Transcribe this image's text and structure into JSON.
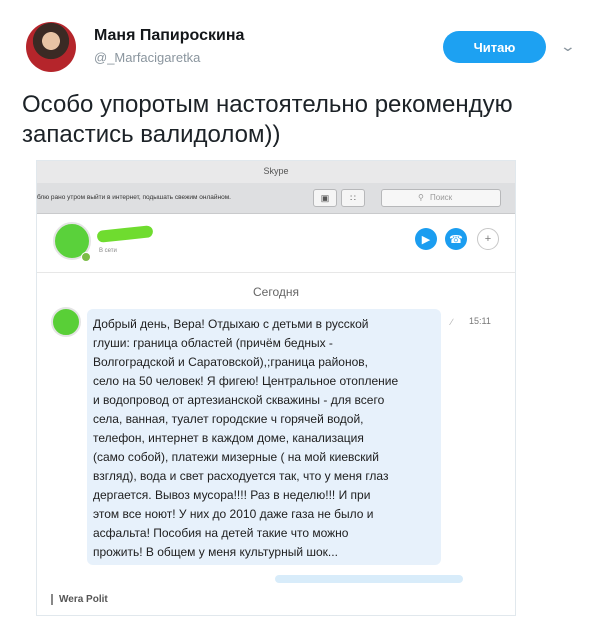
{
  "tweet": {
    "display_name": "Маня Папироскина",
    "handle": "@_Marfacigaretka",
    "follow_label": "Читаю",
    "menu_icon": "chevron-down-icon",
    "text": "Особо упоротым настоятельно рекомендую запастись валидолом))"
  },
  "skype": {
    "window_title": "Skype",
    "status_text": "блю рано утром выйти в интернет, подышать свежим онлайном.",
    "search_placeholder": "Поиск",
    "contact_status": "В сети",
    "date_separator": "Сегодня",
    "message": {
      "time": "15:11",
      "text": "Добрый день, Вера! Отдыхаю с детьми в русской\nглуши: граница областей (причём бедных -\nВолгоградской и Саратовской),;граница районов,\nсело на 50 человек! Я фигею! Центральное отопление\nи водопровод от артезианской скважины - для всего\nсела, ванная, туалет городские ч горячей водой,\nтелефон, интернет в каждом доме,  канализация\n(само собой), платежи мизерные ( на мой киевский\nвзгляд), вода и свет расходуется так, что у меня глаз\nдергается. Вывоз мусора!!!! Раз в неделю!!!  И при\nэтом все ноют! У них до 2010 даже газа не было и\nасфальта! Пособия на детей такие что можно\nпрожить! В общем у меня культурный шок..."
    },
    "watermark": "Wera Polit"
  },
  "colors": {
    "follow_button": "#1da1f2",
    "bubble": "#e7f1fb",
    "call_button": "#1b9df0"
  }
}
